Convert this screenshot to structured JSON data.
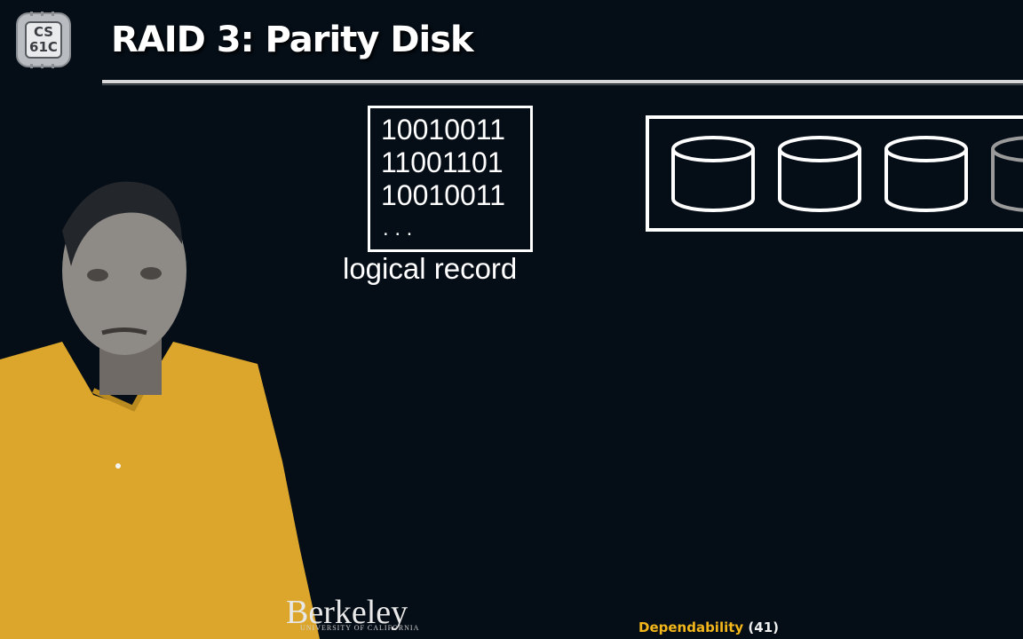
{
  "logo": {
    "line1": "CS",
    "line2": "61C"
  },
  "slide": {
    "title": "RAID 3: Parity Disk"
  },
  "record": {
    "bits": [
      "10010011",
      "11001101",
      "10010011",
      ". . ."
    ],
    "label": "logical record"
  },
  "disks": {
    "count": 4
  },
  "branding": {
    "name": "Berkeley",
    "subtitle": "UNIVERSITY OF CALIFORNIA"
  },
  "footer": {
    "topic": "Dependability",
    "page": "(41)"
  },
  "colors": {
    "background": "#050d16",
    "accent": "#f3b61b",
    "shirt": "#dca62c"
  }
}
